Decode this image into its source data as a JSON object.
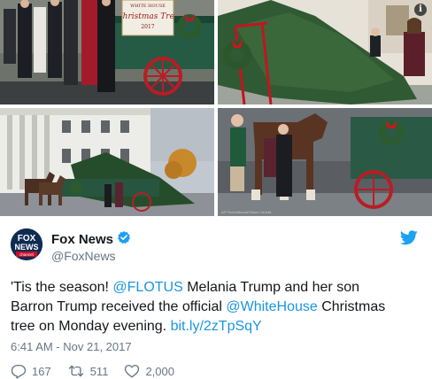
{
  "tweet": {
    "author_name": "Fox News",
    "author_handle": "@FoxNews",
    "avatar_text_top": "FOX",
    "avatar_text_mid": "NEWS",
    "avatar_text_bottom": "channel",
    "text_segments": [
      {
        "text": "'Tis the season! ",
        "type": "text"
      },
      {
        "text": "@FLOTUS",
        "type": "mention"
      },
      {
        "text": " Melania Trump and her son Barron Trump received the official ",
        "type": "text"
      },
      {
        "text": "@WhiteHouse",
        "type": "mention"
      },
      {
        "text": " Christmas tree on Monday evening. ",
        "type": "text"
      },
      {
        "text": "bit.ly/2zTpSqY",
        "type": "link"
      }
    ],
    "timestamp": "6:41 AM - Nov 21, 2017",
    "replies": "167",
    "retweets": "511",
    "likes": "2,000"
  },
  "media": {
    "sign_line1": "WHITE HOUSE",
    "sign_line2": "Christmas Tree",
    "sign_line3": "2017",
    "info_icon": "i",
    "photo_credit": "AP Photo/Manuel Balce Ceneta"
  },
  "colors": {
    "link": "#1b95e0",
    "text": "#14171a",
    "secondary": "#657786"
  },
  "icons": [
    "info-icon",
    "verified-badge-icon",
    "twitter-bird-icon",
    "reply-icon",
    "retweet-icon",
    "like-icon"
  ]
}
